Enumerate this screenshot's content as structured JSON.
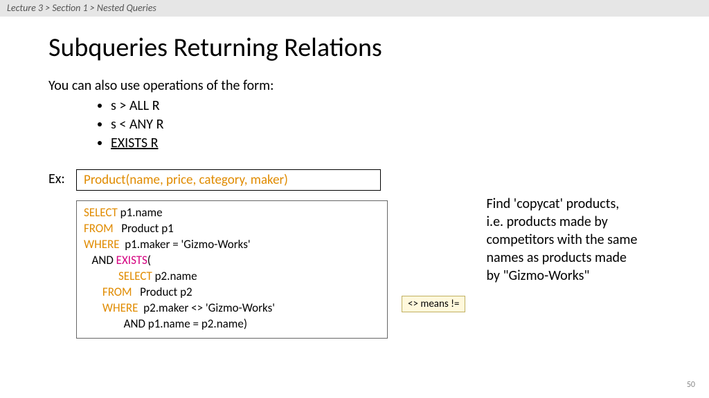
{
  "breadcrumb": "Lecture 3  >  Section 1  >  Nested Queries",
  "title": "Subqueries Returning Relations",
  "intro": "You can also use operations of the form:",
  "ops": [
    "s > ALL R",
    "s < ANY R",
    "EXISTS R"
  ],
  "ex_label": "Ex:",
  "schema": "Product(name, price, category, maker)",
  "code": {
    "l1a": "SELECT",
    "l1b": " p1.name",
    "l2a": "FROM",
    "l2b": "   Product p1",
    "l3a": "WHERE",
    "l3b": "  p1.maker = 'Gizmo-Works'",
    "l4a": "   AND ",
    "l4b": "EXISTS",
    "l4c": "(",
    "l5a": "             ",
    "l5b": "SELECT",
    "l5c": " p2.name",
    "l6a": "       ",
    "l6b": "FROM",
    "l6c": "   Product p2",
    "l7a": "       ",
    "l7b": "WHERE",
    "l7c": "  p2.maker <> 'Gizmo-Works'",
    "l8": "               AND p1.name = p2.name)"
  },
  "callout": "<> means !=",
  "explain": "Find 'copycat' products, i.e. products made by competitors with the same names as products made by \"Gizmo-Works\"",
  "page_number": "50"
}
